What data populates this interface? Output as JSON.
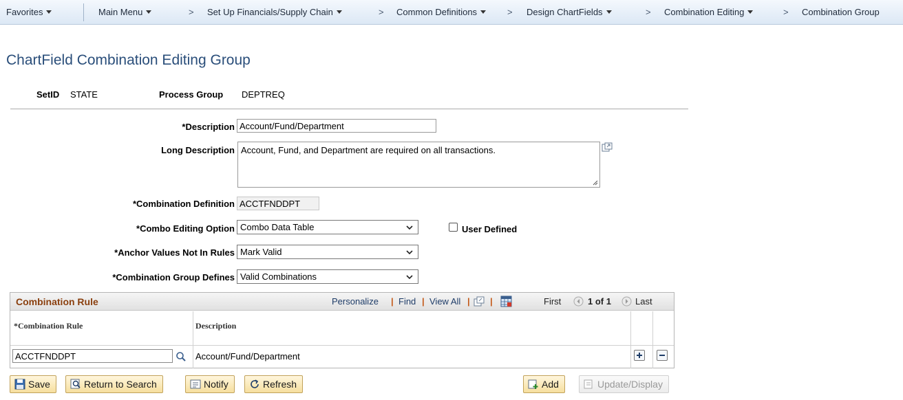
{
  "breadcrumb": {
    "favorites": "Favorites",
    "main_menu": "Main Menu",
    "items": [
      "Set Up Financials/Supply Chain",
      "Common Definitions",
      "Design ChartFields",
      "Combination Editing",
      "Combination Group"
    ],
    "separator": ">"
  },
  "page_title": "ChartField Combination Editing Group",
  "header": {
    "setid_label": "SetID",
    "setid_value": "STATE",
    "process_group_label": "Process Group",
    "process_group_value": "DEPTREQ"
  },
  "form": {
    "description_label": "*Description",
    "description_value": "Account/Fund/Department",
    "long_description_label": "Long Description",
    "long_description_value": "Account, Fund, and Department are required on all transactions.",
    "combination_definition_label": "*Combination Definition",
    "combination_definition_value": "ACCTFNDDPT",
    "combo_editing_option_label": "*Combo Editing Option",
    "combo_editing_option_value": "Combo Data Table",
    "user_defined_label": "User Defined",
    "anchor_values_label": "*Anchor Values Not In Rules",
    "anchor_values_value": "Mark Valid",
    "group_defines_label": "*Combination Group Defines",
    "group_defines_value": "Valid Combinations"
  },
  "grid": {
    "title": "Combination Rule",
    "personalize": "Personalize",
    "find": "Find",
    "view_all": "View All",
    "bar": "|",
    "first": "First",
    "pager": "1 of 1",
    "last": "Last",
    "columns": [
      "*Combination Rule",
      "Description"
    ],
    "rows": [
      {
        "rule": "ACCTFNDDPT",
        "description": "Account/Fund/Department"
      }
    ]
  },
  "buttons": {
    "save": "Save",
    "return_to_search": "Return to Search",
    "notify": "Notify",
    "refresh": "Refresh",
    "add": "Add",
    "update_display": "Update/Display"
  },
  "colors": {
    "title": "#2a4e7a",
    "grid_title": "#8a3f0e",
    "link": "#1e3c68",
    "button_bg": "#f6df9e"
  }
}
